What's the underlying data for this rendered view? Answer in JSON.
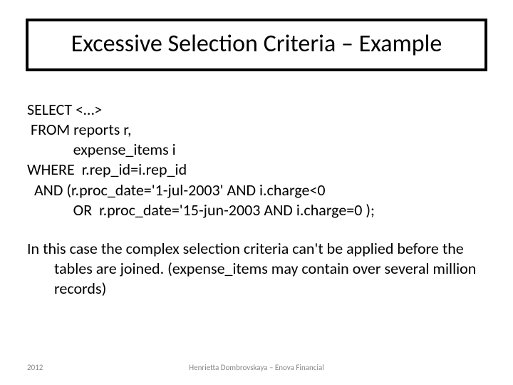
{
  "title": "Excessive Selection Criteria – Example",
  "code": {
    "l1": "SELECT <…>",
    "l2": " FROM reports r,",
    "l3": "             expense_items i",
    "l4": "WHERE  r.rep_id=i.rep_id",
    "l5": "  AND (r.proc_date='1-jul-2003' AND i.charge<0",
    "l6": "             OR  r.proc_date='15-jun-2003 AND i.charge=0 );"
  },
  "paragraph": "In this case the complex selection criteria can't be applied before the tables are joined. (expense_items may contain over several million records)",
  "footer": {
    "year": "2012",
    "author": "Henrietta Dombrovskaya – Enova Financial"
  }
}
